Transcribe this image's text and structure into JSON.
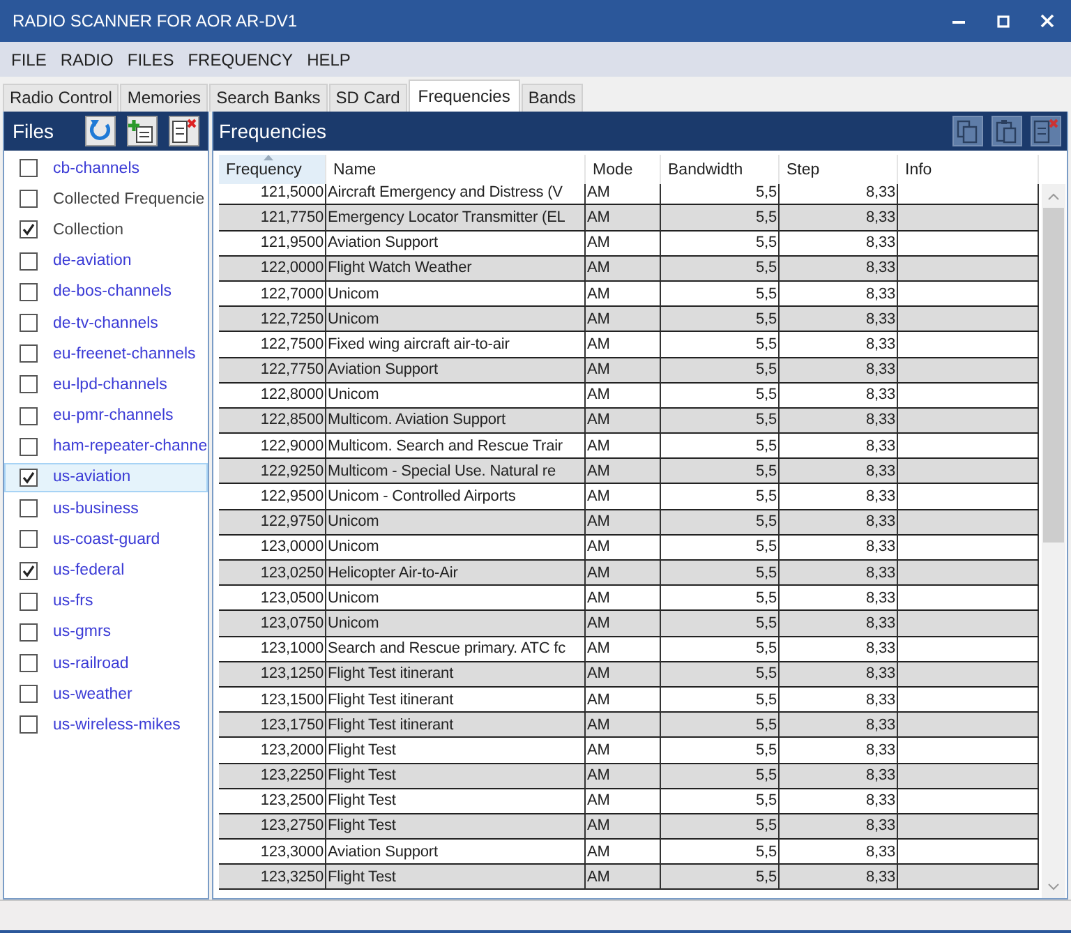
{
  "window": {
    "title": "RADIO SCANNER FOR AOR AR-DV1"
  },
  "menu": [
    "FILE",
    "RADIO",
    "FILES",
    "FREQUENCY",
    "HELP"
  ],
  "tabs": [
    {
      "label": "Radio Control",
      "selected": false
    },
    {
      "label": "Memories",
      "selected": false
    },
    {
      "label": "Search Banks",
      "selected": false
    },
    {
      "label": "SD Card",
      "selected": false
    },
    {
      "label": "Frequencies",
      "selected": true
    },
    {
      "label": "Bands",
      "selected": false
    }
  ],
  "files_panel": {
    "title": "Files",
    "items": [
      {
        "label": "cb-channels",
        "checked": false,
        "selected": false,
        "color": "#3b3bd6"
      },
      {
        "label": "Collected Frequencie",
        "checked": false,
        "selected": false,
        "color": "#444444"
      },
      {
        "label": "Collection",
        "checked": true,
        "selected": false,
        "color": "#444444"
      },
      {
        "label": "de-aviation",
        "checked": false,
        "selected": false,
        "color": "#3b3bd6"
      },
      {
        "label": "de-bos-channels",
        "checked": false,
        "selected": false,
        "color": "#3b3bd6"
      },
      {
        "label": "de-tv-channels",
        "checked": false,
        "selected": false,
        "color": "#3b3bd6"
      },
      {
        "label": "eu-freenet-channels",
        "checked": false,
        "selected": false,
        "color": "#3b3bd6"
      },
      {
        "label": "eu-lpd-channels",
        "checked": false,
        "selected": false,
        "color": "#3b3bd6"
      },
      {
        "label": "eu-pmr-channels",
        "checked": false,
        "selected": false,
        "color": "#3b3bd6"
      },
      {
        "label": "ham-repeater-channe",
        "checked": false,
        "selected": false,
        "color": "#3b3bd6"
      },
      {
        "label": "us-aviation",
        "checked": true,
        "selected": true,
        "color": "#3b3bd6"
      },
      {
        "label": "us-business",
        "checked": false,
        "selected": false,
        "color": "#3b3bd6"
      },
      {
        "label": "us-coast-guard",
        "checked": false,
        "selected": false,
        "color": "#3b3bd6"
      },
      {
        "label": "us-federal",
        "checked": true,
        "selected": false,
        "color": "#3b3bd6"
      },
      {
        "label": "us-frs",
        "checked": false,
        "selected": false,
        "color": "#3b3bd6"
      },
      {
        "label": "us-gmrs",
        "checked": false,
        "selected": false,
        "color": "#3b3bd6"
      },
      {
        "label": "us-railroad",
        "checked": false,
        "selected": false,
        "color": "#3b3bd6"
      },
      {
        "label": "us-weather",
        "checked": false,
        "selected": false,
        "color": "#3b3bd6"
      },
      {
        "label": "us-wireless-mikes",
        "checked": false,
        "selected": false,
        "color": "#3b3bd6"
      }
    ]
  },
  "frequencies_panel": {
    "title": "Frequencies",
    "table": {
      "columns": [
        {
          "label": "Frequency",
          "sorted": true
        },
        {
          "label": "Name",
          "sorted": false
        },
        {
          "label": "Mode",
          "sorted": false
        },
        {
          "label": "Bandwidth",
          "sorted": false
        },
        {
          "label": "Step",
          "sorted": false
        },
        {
          "label": "Info",
          "sorted": false
        }
      ],
      "rows": [
        [
          "121,5000",
          "Aircraft Emergency and Distress (V",
          "AM",
          "5,5",
          "8,33"
        ],
        [
          "121,7750",
          "Emergency Locator Transmitter (EL",
          "AM",
          "5,5",
          "8,33"
        ],
        [
          "121,9500",
          "Aviation Support",
          "AM",
          "5,5",
          "8,33"
        ],
        [
          "122,0000",
          "Flight Watch Weather",
          "AM",
          "5,5",
          "8,33"
        ],
        [
          "122,7000",
          "Unicom",
          "AM",
          "5,5",
          "8,33"
        ],
        [
          "122,7250",
          "Unicom",
          "AM",
          "5,5",
          "8,33"
        ],
        [
          "122,7500",
          "Fixed wing aircraft air-to-air",
          "AM",
          "5,5",
          "8,33"
        ],
        [
          "122,7750",
          "Aviation Support",
          "AM",
          "5,5",
          "8,33"
        ],
        [
          "122,8000",
          "Unicom",
          "AM",
          "5,5",
          "8,33"
        ],
        [
          "122,8500",
          "Multicom. Aviation Support",
          "AM",
          "5,5",
          "8,33"
        ],
        [
          "122,9000",
          "Multicom. Search and Rescue Trair",
          "AM",
          "5,5",
          "8,33"
        ],
        [
          "122,9250",
          "Multicom - Special Use. Natural re",
          "AM",
          "5,5",
          "8,33"
        ],
        [
          "122,9500",
          "Unicom - Controlled Airports",
          "AM",
          "5,5",
          "8,33"
        ],
        [
          "122,9750",
          "Unicom",
          "AM",
          "5,5",
          "8,33"
        ],
        [
          "123,0000",
          "Unicom",
          "AM",
          "5,5",
          "8,33"
        ],
        [
          "123,0250",
          "Helicopter Air-to-Air",
          "AM",
          "5,5",
          "8,33"
        ],
        [
          "123,0500",
          "Unicom",
          "AM",
          "5,5",
          "8,33"
        ],
        [
          "123,0750",
          "Unicom",
          "AM",
          "5,5",
          "8,33"
        ],
        [
          "123,1000",
          "Search and Rescue primary. ATC fc",
          "AM",
          "5,5",
          "8,33"
        ],
        [
          "123,1250",
          "Flight Test itinerant",
          "AM",
          "5,5",
          "8,33"
        ],
        [
          "123,1500",
          "Flight Test itinerant",
          "AM",
          "5,5",
          "8,33"
        ],
        [
          "123,1750",
          "Flight Test itinerant",
          "AM",
          "5,5",
          "8,33"
        ],
        [
          "123,2000",
          "Flight Test",
          "AM",
          "5,5",
          "8,33"
        ],
        [
          "123,2250",
          "Flight Test",
          "AM",
          "5,5",
          "8,33"
        ],
        [
          "123,2500",
          "Flight Test",
          "AM",
          "5,5",
          "8,33"
        ],
        [
          "123,2750",
          "Flight Test",
          "AM",
          "5,5",
          "8,33"
        ],
        [
          "123,3000",
          "Aviation Support",
          "AM",
          "5,5",
          "8,33"
        ],
        [
          "123,3250",
          "Flight Test",
          "AM",
          "5,5",
          "8,33"
        ]
      ]
    }
  }
}
